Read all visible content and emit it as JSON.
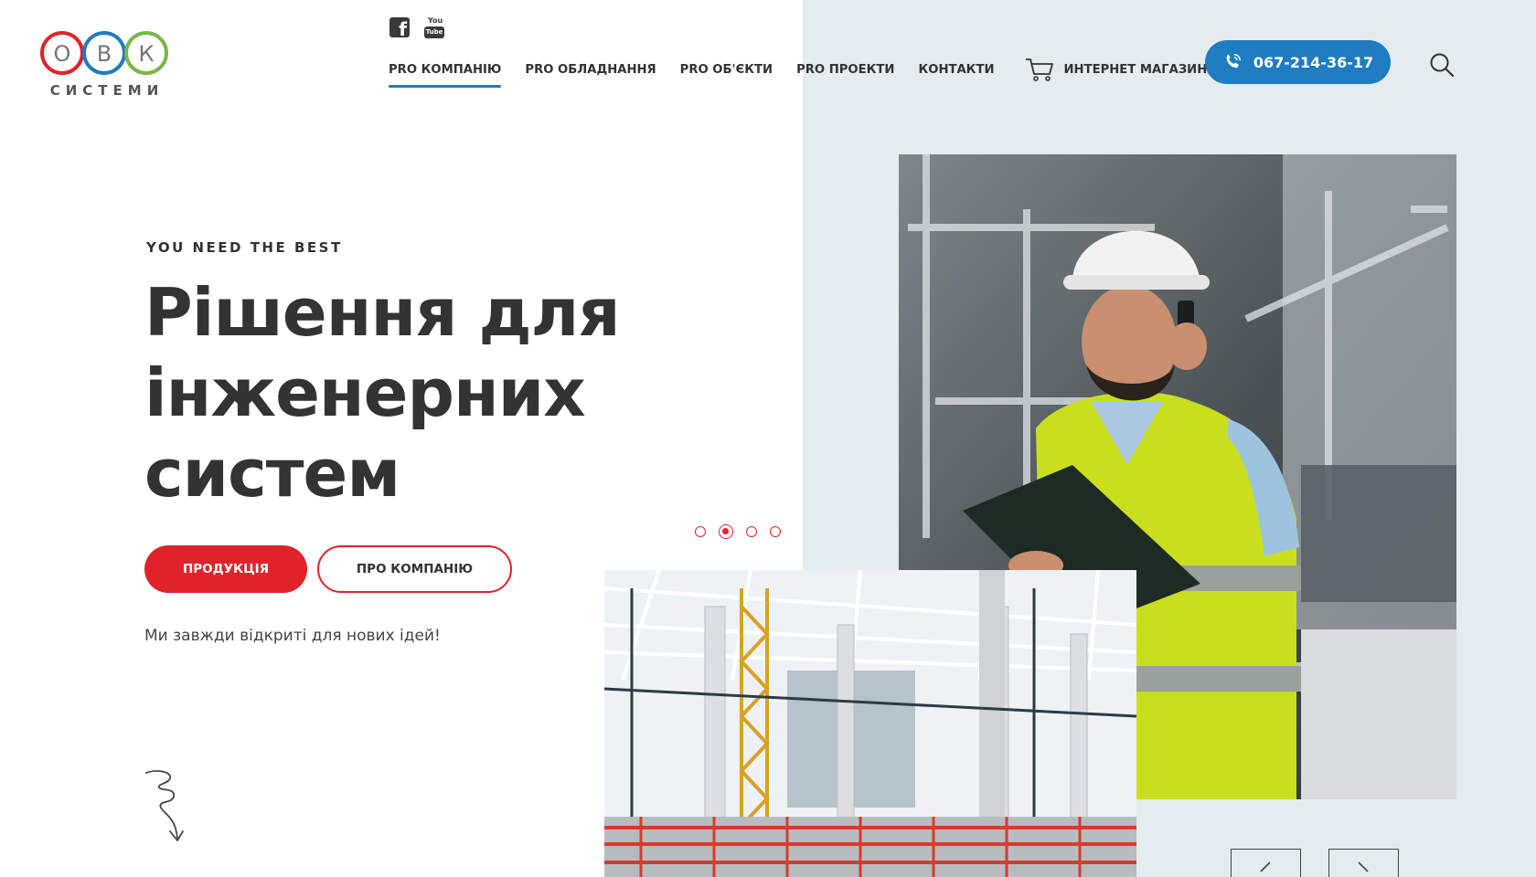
{
  "logo": {
    "letters": [
      "О",
      "В",
      "К"
    ],
    "subtitle": "СИСТЕМИ",
    "colors": [
      "#e0232b",
      "#1f7cc1",
      "#7ab648"
    ]
  },
  "social": {
    "facebook_glyph": "f",
    "youtube_top": "You",
    "youtube_box": "Tube"
  },
  "nav": {
    "items": [
      {
        "label": "PRO КОМПАНІЮ",
        "active": true
      },
      {
        "label": "PRO ОБЛАДНАННЯ"
      },
      {
        "label": "PRO ОБ'ЄКТИ"
      },
      {
        "label": "PRO ПРОЕКТИ"
      },
      {
        "label": "КОНТАКТИ"
      }
    ],
    "shop_label": "ИНТЕРНЕТ МАГАЗИН",
    "shop_icon": "cart-icon"
  },
  "phone": {
    "number": "067-214-36-17",
    "icon": "phone-icon"
  },
  "search": {
    "icon": "search-icon"
  },
  "hero": {
    "eyebrow": "YOU NEED THE BEST",
    "title_lines": [
      "Рішення для",
      "інженерних",
      "систем"
    ],
    "primary_button": "ПРОДУКЦІЯ",
    "secondary_button": "ПРО КОМПАНІЮ",
    "tagline": "Ми завжди відкриті для нових ідей!"
  },
  "slider": {
    "count": 4,
    "active_index": 1
  },
  "colors": {
    "accent_red": "#e0232b",
    "accent_blue": "#1f7cc1",
    "panel_bg": "#e3ecee",
    "text": "#333333"
  }
}
